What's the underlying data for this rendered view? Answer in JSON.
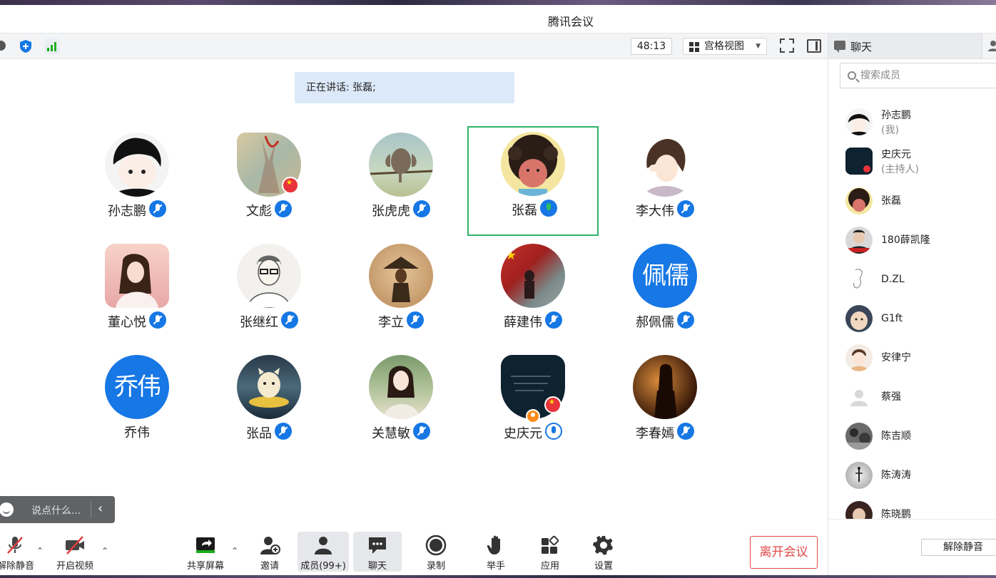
{
  "window": {
    "title": "腾讯会议"
  },
  "toolbar": {
    "timer": "48:13",
    "view_label": "宫格视图"
  },
  "side_tabs": {
    "chat_label": "聊天"
  },
  "stage": {
    "speaking_text": "正在讲话: 张磊;",
    "participants": [
      {
        "name": "孙志鹏",
        "mic": "muted"
      },
      {
        "name": "文彪",
        "mic": "muted"
      },
      {
        "name": "张虎虎",
        "mic": "muted"
      },
      {
        "name": "张磊",
        "mic": "active"
      },
      {
        "name": "李大伟",
        "mic": "muted"
      },
      {
        "name": "董心悦",
        "mic": "muted"
      },
      {
        "name": "张继红",
        "mic": "muted"
      },
      {
        "name": "李立",
        "mic": "muted"
      },
      {
        "name": "薛建伟",
        "mic": "muted"
      },
      {
        "name": "郝佩儒",
        "mic": "muted",
        "avatar_text": "佩儒"
      },
      {
        "name": "乔伟",
        "mic": "none",
        "avatar_text": "乔伟"
      },
      {
        "name": "张品",
        "mic": "muted"
      },
      {
        "name": "关慧敏",
        "mic": "muted"
      },
      {
        "name": "史庆元",
        "mic": "on"
      },
      {
        "name": "李春嫣",
        "mic": "muted"
      }
    ],
    "chat_placeholder": "说点什么..."
  },
  "bottom": {
    "unmute_label": "解除静音",
    "video_label": "开启视频",
    "share_label": "共享屏幕",
    "invite_label": "邀请",
    "members_label": "成员(99+)",
    "chat_label": "聊天",
    "record_label": "录制",
    "raise_hand_label": "举手",
    "apps_label": "应用",
    "settings_label": "设置",
    "leave_label": "离开会议"
  },
  "sidebar": {
    "search_placeholder": "搜索成员",
    "members": [
      {
        "name": "孙志鹏",
        "role": "(我)"
      },
      {
        "name": "史庆元",
        "role": "(主持人)"
      },
      {
        "name": "张磊"
      },
      {
        "name": "180薛凯隆"
      },
      {
        "name": "D.ZL"
      },
      {
        "name": "G1ft"
      },
      {
        "name": "安律宁"
      },
      {
        "name": "蔡强"
      },
      {
        "name": "陈吉顺"
      },
      {
        "name": "陈涛涛"
      },
      {
        "name": "陈晓鹏"
      }
    ],
    "unmute_all_label": "解除静音"
  },
  "colors": {
    "accent": "#1677e5",
    "speaking_bg": "#dce9f9",
    "highlight_border": "#2db56a",
    "leave_red": "#e04848"
  }
}
